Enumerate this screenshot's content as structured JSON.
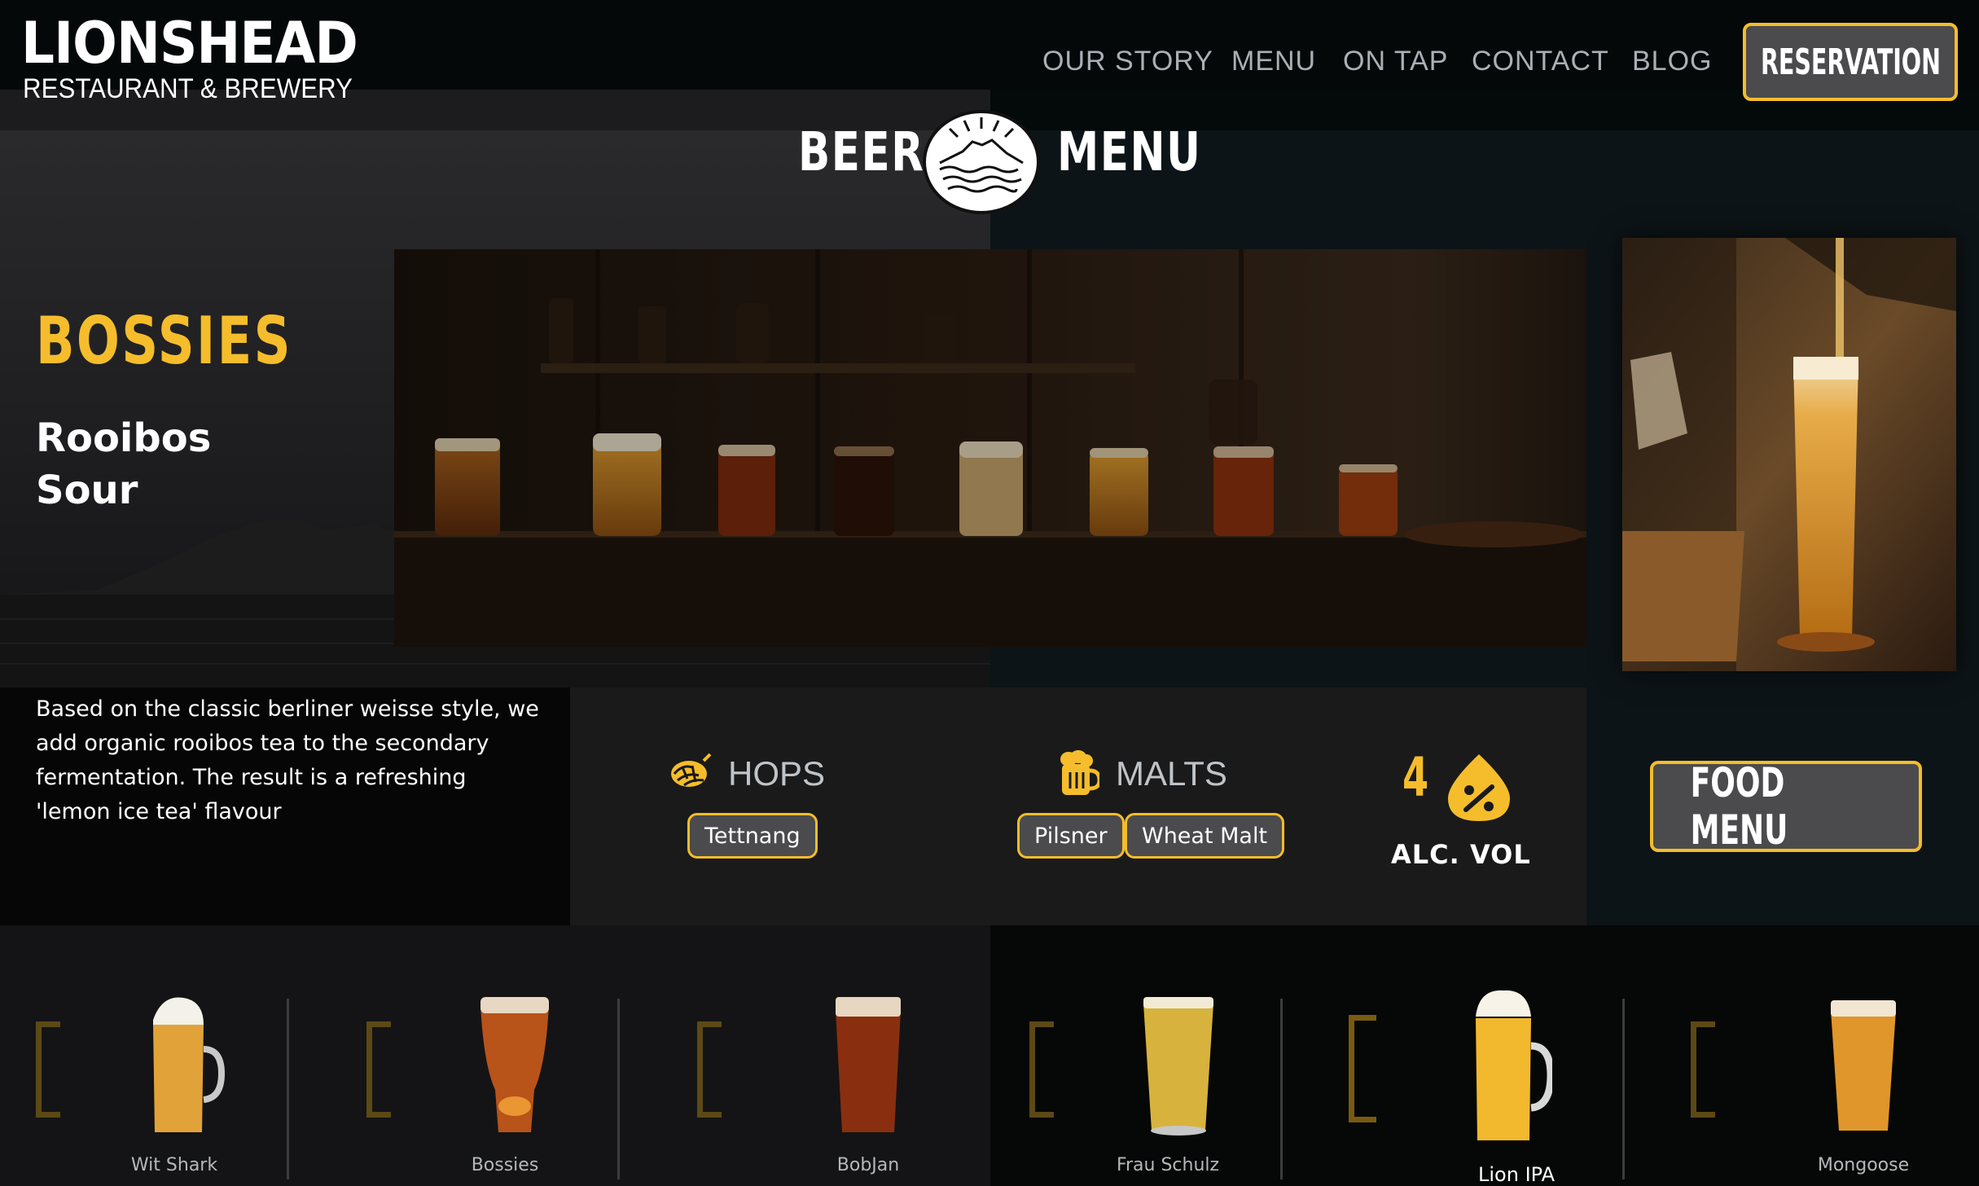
{
  "brand": {
    "name": "LIONSHEAD",
    "subtitle": "RESTAURANT & BREWERY"
  },
  "nav": {
    "items": [
      "OUR STORY",
      "MENU",
      "ON TAP",
      "CONTACT",
      "BLOG"
    ],
    "reservation_label": "RESERVATION"
  },
  "page_heading": {
    "left": "BEER",
    "right": "MENU",
    "emblem_icon": "mountain-sea-emblem-icon"
  },
  "featured_beer": {
    "name": "BOSSIES",
    "style": "Rooibos Sour",
    "description": "Based on the classic berliner weisse style, we add organic rooibos tea to the secondary fermentation. The result is a refreshing 'lemon ice tea' flavour",
    "hops": {
      "title": "HOPS",
      "icon": "hop-icon",
      "items": [
        "Tettnang"
      ]
    },
    "malts": {
      "title": "MALTS",
      "icon": "beer-mug-icon",
      "items": [
        "Pilsner",
        "Wheat Malt"
      ]
    },
    "abv": {
      "value": "4",
      "label": "ALC. VOL",
      "icon": "percent-drop-icon"
    }
  },
  "food_menu_label": "FOOD MENU",
  "beer_list": [
    {
      "name": "Wit Shark"
    },
    {
      "name": "Bossies"
    },
    {
      "name": "BobJan"
    },
    {
      "name": "Frau Schulz"
    },
    {
      "name": "Lion IPA"
    },
    {
      "name": "Mongoose"
    }
  ],
  "colors": {
    "accent": "#f5bd2b",
    "button_bg": "#4b4b4d",
    "nav_text": "#a9b0b6",
    "header_bg": "#04080a"
  }
}
